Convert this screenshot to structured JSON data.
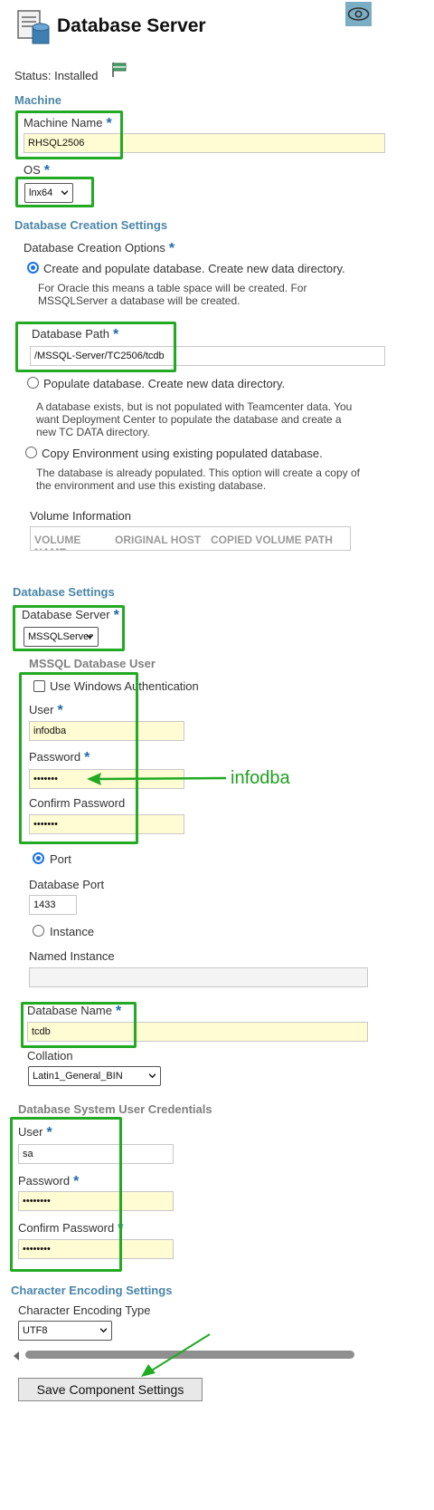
{
  "header": {
    "title": "Database Server",
    "status_text": "Status: Installed"
  },
  "machine": {
    "section_title": "Machine",
    "machine_name_label": "Machine Name",
    "machine_name_value": "RHSQL2506",
    "os_label": "OS",
    "os_selected": "lnx64",
    "required_mark": "*"
  },
  "db_creation": {
    "section_title": "Database Creation Settings",
    "options_label": "Database Creation Options",
    "option_create": "Create and populate database. Create new data directory.",
    "option_create_desc": "For Oracle this means a table space will be created. For MSSQLServer a database will be created.",
    "db_path_label": "Database Path",
    "db_path_value": "/MSSQL-Server/TC2506/tcdb",
    "option_populate": "Populate database. Create new data directory.",
    "option_populate_desc": "A database exists, but is not populated with Teamcenter data. You want Deployment Center to populate the database and create a new TC DATA directory.",
    "option_copy": "Copy Environment using existing populated database.",
    "option_copy_desc": "The database is already populated. This option will create a copy of the environment and use this existing database.",
    "volume_info_label": "Volume Information",
    "volume_columns": [
      "VOLUME NAME",
      "ORIGINAL HOST",
      "COPIED VOLUME PATH"
    ]
  },
  "db_settings": {
    "section_title": "Database Settings",
    "server_label": "Database Server",
    "server_selected": "MSSQLServer",
    "mssql_user_title": "MSSQL Database User",
    "windows_auth_label": "Use Windows Authentication",
    "user_label": "User",
    "user_value": "infodba",
    "password_label": "Password",
    "password_value": "•••••••",
    "confirm_password_label": "Confirm Password",
    "confirm_password_value": "•••••••",
    "annotation": "infodba",
    "port_option": "Port",
    "port_label": "Database Port",
    "port_value": "1433",
    "instance_option": "Instance",
    "named_instance_label": "Named Instance",
    "named_instance_value": "",
    "db_name_label": "Database Name",
    "db_name_value": "tcdb",
    "collation_label": "Collation",
    "collation_selected": "Latin1_General_BIN"
  },
  "system_user": {
    "section_title": "Database System User Credentials",
    "user_label": "User",
    "user_value": "sa",
    "password_label": "Password",
    "password_value": "••••••••",
    "confirm_password_label": "Confirm Password",
    "confirm_password_value": "••••••••"
  },
  "encoding": {
    "section_title": "Character Encoding Settings",
    "type_label": "Character Encoding Type",
    "type_selected": "UTF8"
  },
  "footer": {
    "save_label": "Save Component Settings"
  },
  "colors": {
    "section_blue": "#4a86a8",
    "required_blue": "#1f6cab",
    "field_yellow": "#fffbd3",
    "annotation_green": "#22aa22",
    "radio_blue": "#1a73e8"
  },
  "icons": [
    "database-server-icon",
    "eye-icon",
    "status-flag-icon",
    "chevron-down-icon",
    "arrow-annotation-icon"
  ]
}
